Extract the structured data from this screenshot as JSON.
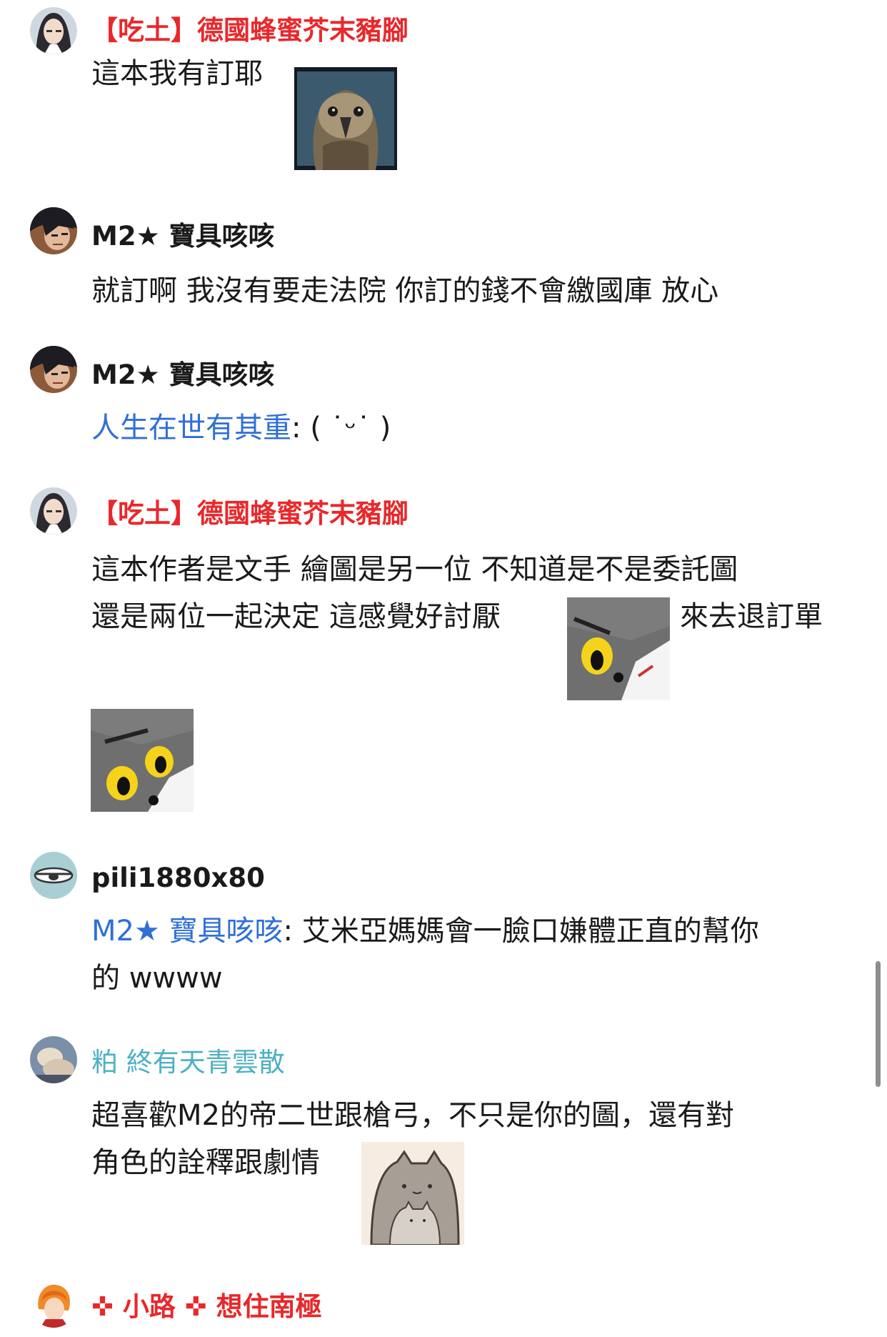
{
  "colors": {
    "red_name": "#e8282b",
    "teal_name": "#4db0c3",
    "mention": "#2f6fd6",
    "text": "#1a1a1a"
  },
  "comments": [
    {
      "author": "【吃土】德國蜂蜜芥末豬腳",
      "text": "這本我有訂耶",
      "sticker": "owl-sticker"
    },
    {
      "author": "M2★ 寶具咳咳",
      "text": "就訂啊 我沒有要走法院 你訂的錢不會繳國庫 放心"
    },
    {
      "author": "M2★ 寶具咳咳",
      "mention": "人生在世有其重",
      "text": ": ( ˙ᵕ˙ )"
    },
    {
      "author": "【吃土】德國蜂蜜芥末豬腳",
      "line1": "這本作者是文手 繪圖是另一位 不知道是不是委託圖",
      "line2a": "還是兩位一起決定 這感覺好討厭",
      "line2b": "來去退訂單",
      "sticker": "tom-cat-sticker"
    },
    {
      "author": "pili1880x80",
      "mention": "M2★ 寶具咳咳",
      "line1": ": 艾米亞媽媽會一臉口嫌體正直的幫你",
      "line2": "的 wwww"
    },
    {
      "author": "粕 終有天青雲散",
      "line1": "超喜歡M2的帝二世跟槍弓，不只是你的圖，還有對",
      "line2": "角色的詮釋跟劇情",
      "sticker": "pusheen-sticker"
    },
    {
      "author": "✜ 小路 ✜ 想住南極"
    }
  ]
}
